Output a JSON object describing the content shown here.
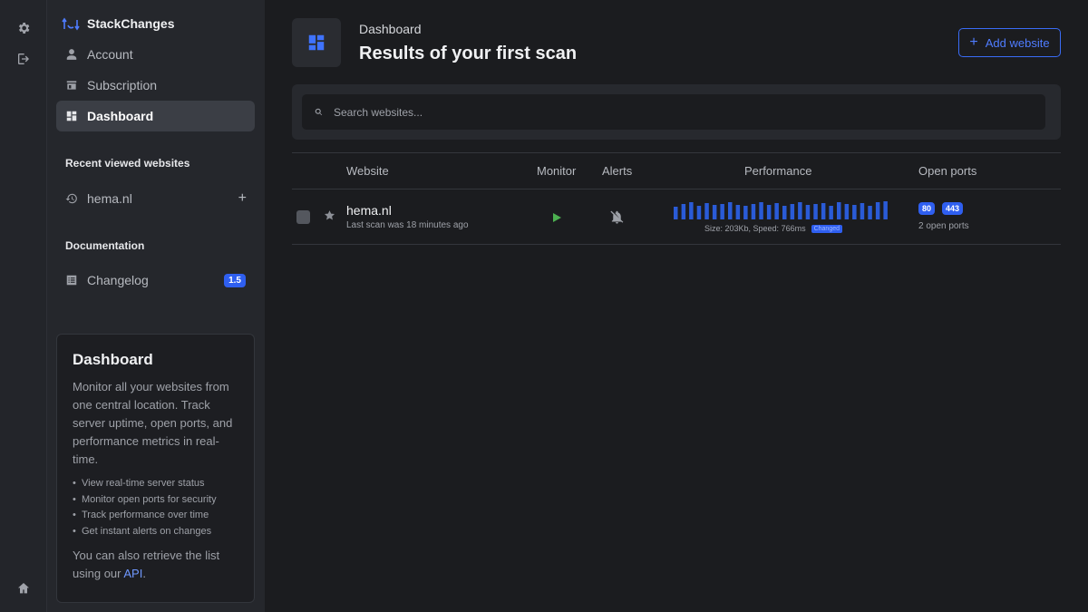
{
  "brand": {
    "name": "StackChanges"
  },
  "sidebar": {
    "items": [
      {
        "label": "Account",
        "icon": "user-icon"
      },
      {
        "label": "Subscription",
        "icon": "store-icon"
      },
      {
        "label": "Dashboard",
        "icon": "dashboard-icon",
        "active": true
      }
    ],
    "recent_title": "Recent viewed websites",
    "recent_items": [
      {
        "label": "hema.nl",
        "icon": "history-icon"
      }
    ],
    "recent_add": "+",
    "docs_title": "Documentation",
    "docs_items": [
      {
        "label": "Changelog",
        "badge": "1.5",
        "icon": "list-icon"
      }
    ]
  },
  "info_card": {
    "title": "Dashboard",
    "text": "Monitor all your websites from one central location. Track server uptime, open ports, and performance metrics in real-time.",
    "bullets": [
      "View real-time server status",
      "Monitor open ports for security",
      "Track performance over time",
      "Get instant alerts on changes"
    ],
    "footer_prefix": "You can also retrieve the list using our ",
    "footer_link": "API",
    "footer_suffix": "."
  },
  "header": {
    "breadcrumb": "Dashboard",
    "title": "Results of your first scan",
    "add_button": "Add website"
  },
  "search": {
    "placeholder": "Search websites..."
  },
  "table": {
    "columns": [
      "Website",
      "Monitor",
      "Alerts",
      "Performance",
      "Open ports"
    ],
    "rows": [
      {
        "site": "hema.nl",
        "last_scan": "Last scan was 18 minutes ago",
        "performance_text": "Size: 203Kb, Speed: 766ms",
        "performance_tag": "Changed",
        "performance_bars": [
          0.7,
          0.85,
          0.95,
          0.75,
          0.9,
          0.8,
          0.85,
          0.95,
          0.8,
          0.75,
          0.85,
          0.95,
          0.8,
          0.9,
          0.75,
          0.85,
          0.95,
          0.8,
          0.85,
          0.9,
          0.75,
          0.95,
          0.85,
          0.8,
          0.9,
          0.75,
          0.95,
          1.0
        ],
        "ports": [
          "80",
          "443"
        ],
        "ports_summary": "2 open ports"
      }
    ]
  },
  "colors": {
    "accent": "#2f5ff0",
    "play": "#4caf50",
    "bars": "#2a5bd7"
  }
}
